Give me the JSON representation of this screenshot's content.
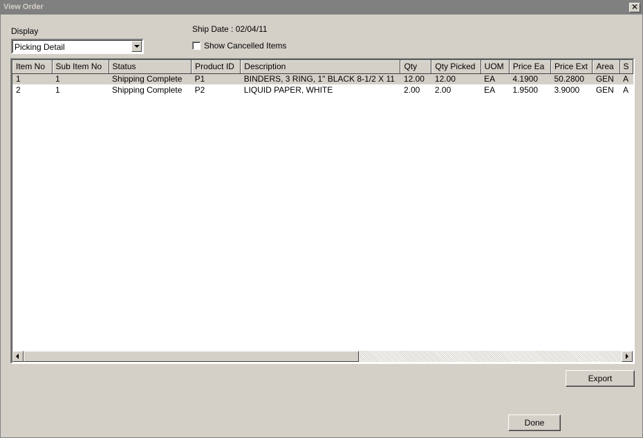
{
  "window": {
    "title": "View Order",
    "close_glyph": "✕"
  },
  "display": {
    "label": "Display",
    "selected": "Picking Detail"
  },
  "ship_date": "Ship Date : 02/04/11",
  "show_cancelled": {
    "label": "Show Cancelled Items",
    "checked": false
  },
  "grid": {
    "columns": [
      "Item No",
      "Sub Item No",
      "Status",
      "Product ID",
      "Description",
      "Qty",
      "Qty Picked",
      "UOM",
      "Price Ea",
      "Price Ext",
      "Area",
      "S"
    ],
    "rows": [
      [
        "1",
        "1",
        "Shipping Complete",
        "P1",
        "BINDERS, 3 RING, 1\" BLACK 8-1/2 X 11",
        "12.00",
        "12.00",
        "EA",
        "4.1900",
        "50.2800",
        "GEN",
        "A"
      ],
      [
        "2",
        "1",
        "Shipping Complete",
        "P2",
        "LIQUID PAPER, WHITE",
        "2.00",
        "2.00",
        "EA",
        "1.9500",
        "3.9000",
        "GEN",
        "A"
      ]
    ],
    "selected_row": 0
  },
  "buttons": {
    "export": "Export",
    "done": "Done"
  },
  "colors": {
    "face": "#d4d0c8",
    "titlebar": "#808080"
  }
}
